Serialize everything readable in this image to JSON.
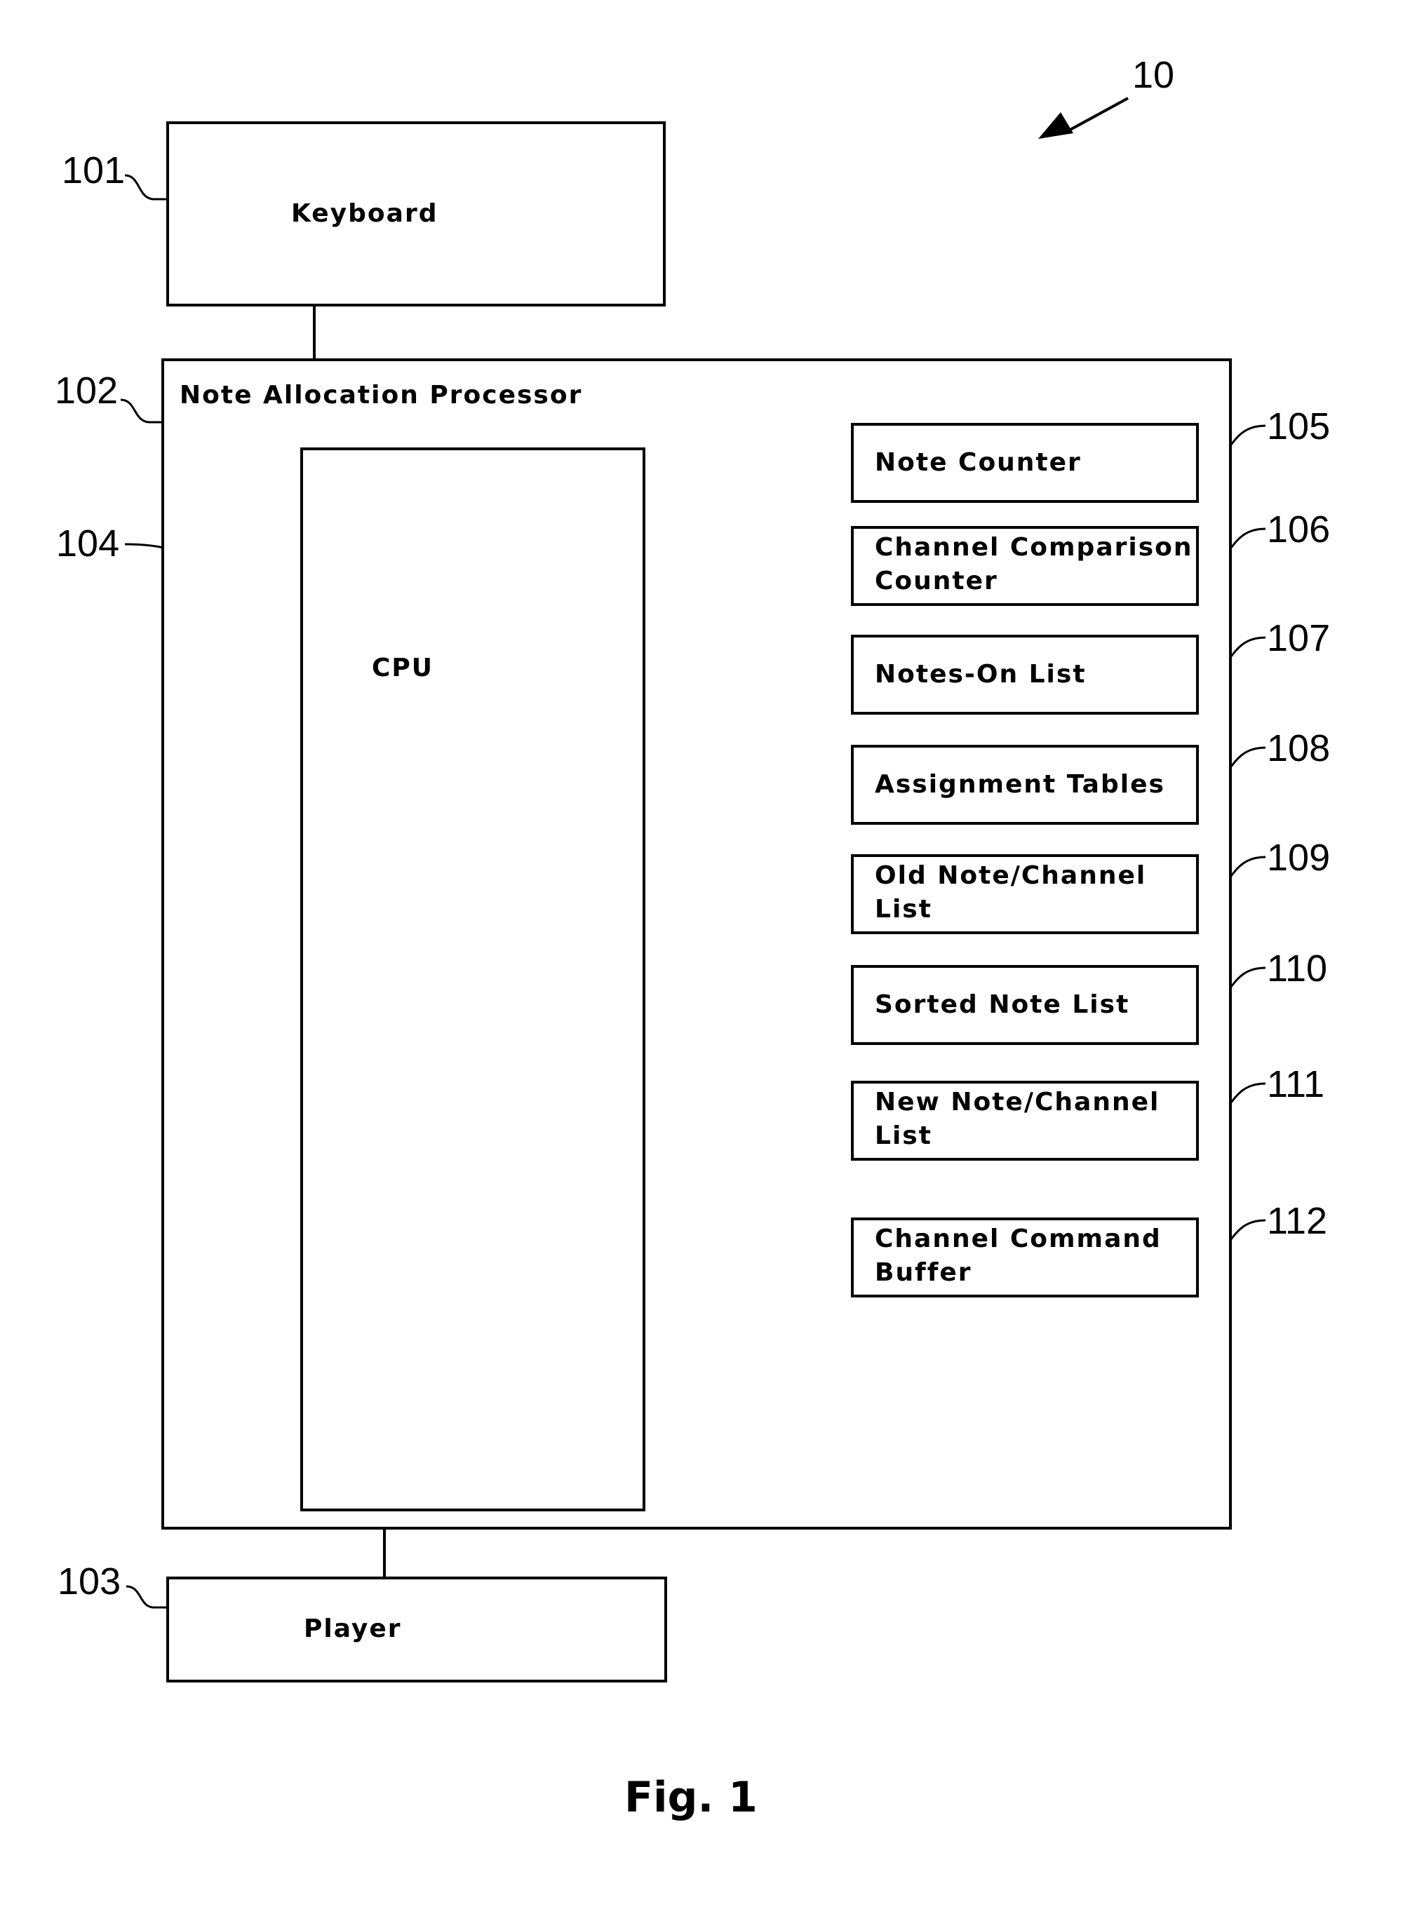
{
  "figure": {
    "caption": "Fig. 1",
    "system_ref": "10"
  },
  "keyboard": {
    "ref": "101",
    "label": "Keyboard"
  },
  "processor": {
    "ref": "102",
    "label": "Note Allocation Processor"
  },
  "player": {
    "ref": "103",
    "label": "Player"
  },
  "cpu": {
    "ref": "104",
    "label": "CPU"
  },
  "modules": [
    {
      "ref": "105",
      "line1": "Note Counter",
      "line2": ""
    },
    {
      "ref": "106",
      "line1": "Channel Comparison",
      "line2": "Counter"
    },
    {
      "ref": "107",
      "line1": "Notes-On List",
      "line2": ""
    },
    {
      "ref": "108",
      "line1": "Assignment Tables",
      "line2": ""
    },
    {
      "ref": "109",
      "line1": "Old Note/Channel",
      "line2": "List"
    },
    {
      "ref": "110",
      "line1": "Sorted Note List",
      "line2": ""
    },
    {
      "ref": "111",
      "line1": "New Note/Channel",
      "line2": "List"
    },
    {
      "ref": "112",
      "line1": "Channel Command",
      "line2": "Buffer"
    }
  ]
}
